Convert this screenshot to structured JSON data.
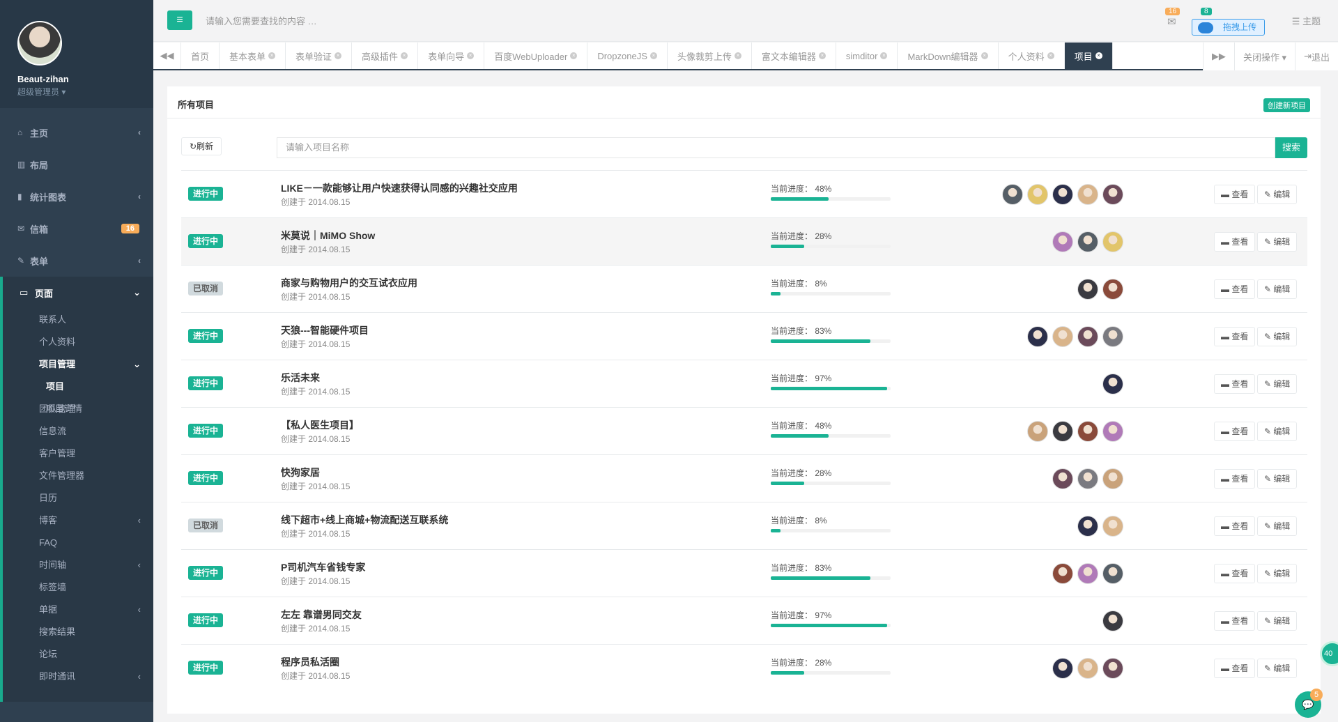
{
  "colors": {
    "accent": "#1ab394",
    "sidebar": "#2f4050",
    "warning": "#f8ac59",
    "cancel": "#d1dade"
  },
  "profile": {
    "name": "Beaut-zihan",
    "role": "超级管理员 ▾"
  },
  "nav": {
    "home": "主页",
    "layout": "布局",
    "charts": "统计图表",
    "mail": "信箱",
    "mail_badge": "16",
    "forms": "表单",
    "pages": "页面",
    "sub": {
      "contacts": "联系人",
      "profile": "个人资料",
      "projects_mgmt": "项目管理",
      "projects": "项目",
      "project_detail": "项目详情",
      "team": "团队管理",
      "feed": "信息流",
      "clients": "客户管理",
      "files": "文件管理器",
      "calendar": "日历",
      "blog": "博客",
      "faq": "FAQ",
      "timeline": "时间轴",
      "tags": "标签墙",
      "invoice": "单据",
      "search": "搜索结果",
      "forum": "论坛",
      "im": "即时通讯"
    }
  },
  "topbar": {
    "search_placeholder": "请输入您需要查找的内容 …",
    "mail_count": "16",
    "notify_count": "8",
    "upload": "拖拽上传",
    "theme": "主题"
  },
  "tabs": [
    "首页",
    "基本表单",
    "表单验证",
    "高级插件",
    "表单向导",
    "百度WebUploader",
    "DropzoneJS",
    "头像裁剪上传",
    "富文本编辑器",
    "simditor",
    "MarkDown编辑器",
    "个人资料",
    "项目"
  ],
  "tabs_right": {
    "close_ops": "关闭操作 ▾",
    "logout": "退出"
  },
  "panel": {
    "title": "所有项目",
    "create": "创建新项目",
    "refresh": "刷新",
    "search_placeholder": "请输入项目名称",
    "search_btn": "搜索",
    "view_btn": "查看",
    "edit_btn": "编辑"
  },
  "projects": [
    {
      "status": "进行中",
      "active": true,
      "title": "LIKE－一款能够让用户快速获得认同感的兴趣社交应用",
      "date": "创建于 2014.08.15",
      "progress_label": "当前进度： 48%",
      "progress": 48,
      "members": 5
    },
    {
      "status": "进行中",
      "active": true,
      "title": "米莫说｜MiMO Show",
      "date": "创建于 2014.08.15",
      "progress_label": "当前进度： 28%",
      "progress": 28,
      "members": 3
    },
    {
      "status": "已取消",
      "active": false,
      "title": "商家与购物用户的交互试衣应用",
      "date": "创建于 2014.08.15",
      "progress_label": "当前进度： 8%",
      "progress": 8,
      "members": 2
    },
    {
      "status": "进行中",
      "active": true,
      "title": "天狼---智能硬件项目",
      "date": "创建于 2014.08.15",
      "progress_label": "当前进度： 83%",
      "progress": 83,
      "members": 4
    },
    {
      "status": "进行中",
      "active": true,
      "title": "乐活未来",
      "date": "创建于 2014.08.15",
      "progress_label": "当前进度： 97%",
      "progress": 97,
      "members": 1
    },
    {
      "status": "进行中",
      "active": true,
      "title": "【私人医生项目】",
      "date": "创建于 2014.08.15",
      "progress_label": "当前进度： 48%",
      "progress": 48,
      "members": 4
    },
    {
      "status": "进行中",
      "active": true,
      "title": "快狗家居",
      "date": "创建于 2014.08.15",
      "progress_label": "当前进度： 28%",
      "progress": 28,
      "members": 3
    },
    {
      "status": "已取消",
      "active": false,
      "title": "线下超市+线上商城+物流配送互联系统",
      "date": "创建于 2014.08.15",
      "progress_label": "当前进度： 8%",
      "progress": 8,
      "members": 2
    },
    {
      "status": "进行中",
      "active": true,
      "title": "P司机汽车省钱专家",
      "date": "创建于 2014.08.15",
      "progress_label": "当前进度： 83%",
      "progress": 83,
      "members": 3
    },
    {
      "status": "进行中",
      "active": true,
      "title": "左左 靠谱男同交友",
      "date": "创建于 2014.08.15",
      "progress_label": "当前进度： 97%",
      "progress": 97,
      "members": 1
    },
    {
      "status": "进行中",
      "active": true,
      "title": "程序员私活圈",
      "date": "创建于 2014.08.15",
      "progress_label": "当前进度： 28%",
      "progress": 28,
      "members": 3
    }
  ],
  "floating": {
    "side_badge": "40",
    "chat_badge": "5"
  }
}
